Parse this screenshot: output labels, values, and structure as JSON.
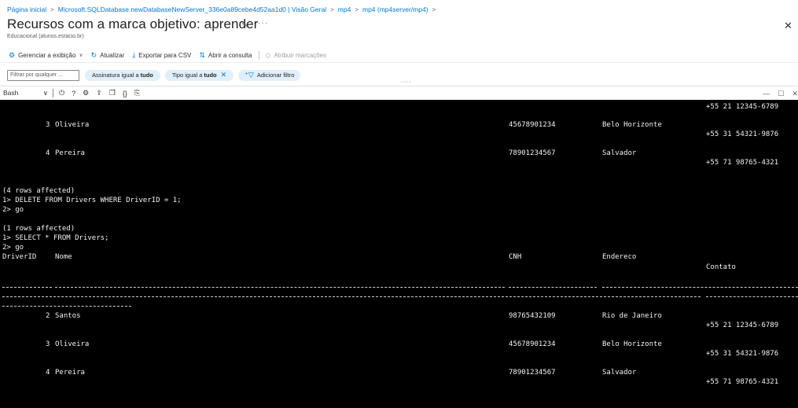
{
  "breadcrumb": [
    "Página inicial",
    "Microsoft.SQLDatabase.newDatabaseNewServer_336e0a89cebe4d52aa1d0 | Visão Geral",
    "mp4",
    "mp4 (mp4server/mp4)"
  ],
  "page": {
    "title": "Recursos com a marca objetivo: aprender",
    "subtitle": "Educacional (alunos.estacio.br)"
  },
  "toolbar": {
    "manage_view": "Gerenciar a exibição",
    "refresh": "Atualizar",
    "export_csv": "Exportar para CSV",
    "open_query": "Abrir a consulta",
    "assign_tags": "Atribuir marcações"
  },
  "filters": {
    "placeholder": "Filtrar por qualquer ...",
    "subscription_label": "Assinatura igual a",
    "subscription_value": "tudo",
    "type_label": "Tipo igual a",
    "type_value": "tudo",
    "add_filter": "Adicionar filtro"
  },
  "shell": {
    "selected": "Bash"
  },
  "terminal": {
    "top_rows": [
      {
        "contato": "+55 21 12345-6789"
      },
      {
        "id": "3",
        "nome": "Oliveira",
        "cnh": "45678901234",
        "endereco": "Belo Horizonte",
        "contato": "+55 31 54321-9876"
      },
      {
        "id": "4",
        "nome": "Pereira",
        "cnh": "78901234567",
        "endereco": "Salvador",
        "contato": "+55 71 98765-4321"
      }
    ],
    "rows_affected_4": "(4 rows affected)",
    "delete_cmd": "1> DELETE FROM Drivers WHERE DriverID = 1;",
    "go1": "2> go",
    "rows_affected_1": "(1 rows affected)",
    "select_cmd": "1> SELECT * FROM Drivers;",
    "go2": "2> go",
    "headers": {
      "id": "DriverID",
      "nome": "Nome",
      "cnh": "CNH",
      "endereco": "Endereco",
      "contato": "Contato"
    },
    "rows": [
      {
        "id": "2",
        "nome": "Santos",
        "cnh": "98765432109",
        "endereco": "Rio de Janeiro",
        "contato": "+55 21 12345-6789"
      },
      {
        "id": "3",
        "nome": "Oliveira",
        "cnh": "45678901234",
        "endereco": "Belo Horizonte",
        "contato": "+55 31 54321-9876"
      },
      {
        "id": "4",
        "nome": "Pereira",
        "cnh": "78901234567",
        "endereco": "Salvador",
        "contato": "+55 71 98765-4321"
      }
    ]
  },
  "colors": {
    "accent": "#0078d4",
    "terminal_bg": "#000000",
    "terminal_fg": "#f2f2f2",
    "pill_bg": "#e1effa"
  }
}
